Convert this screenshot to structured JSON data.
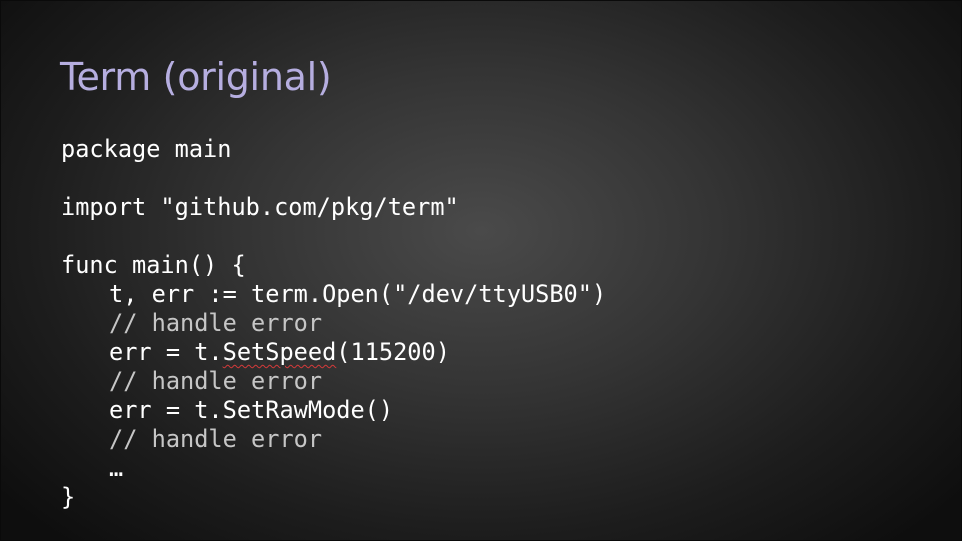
{
  "slide": {
    "title": "Term (original)",
    "code": {
      "line1": "package main",
      "line2": "",
      "line3": "import \"github.com/pkg/term\"",
      "line4": "",
      "line5": "func main() {",
      "line6": "t, err := term.Open(\"/dev/ttyUSB0\")",
      "line7": "// handle error",
      "line8_prefix": "err = t.",
      "line8_flagged": "SetSpeed",
      "line8_suffix": "(115200)",
      "line9": "// handle error",
      "line10": "err = t.SetRawMode()",
      "line11": "// handle error",
      "line12": "…",
      "line13": "}"
    }
  },
  "colors": {
    "title": "#b6aee0",
    "code_text": "#ffffff",
    "comment_text": "#c6c6c6",
    "spellcheck_underline": "#d43a3a",
    "background_center": "#4a4a4a",
    "background_edge": "#0e0e0e"
  }
}
